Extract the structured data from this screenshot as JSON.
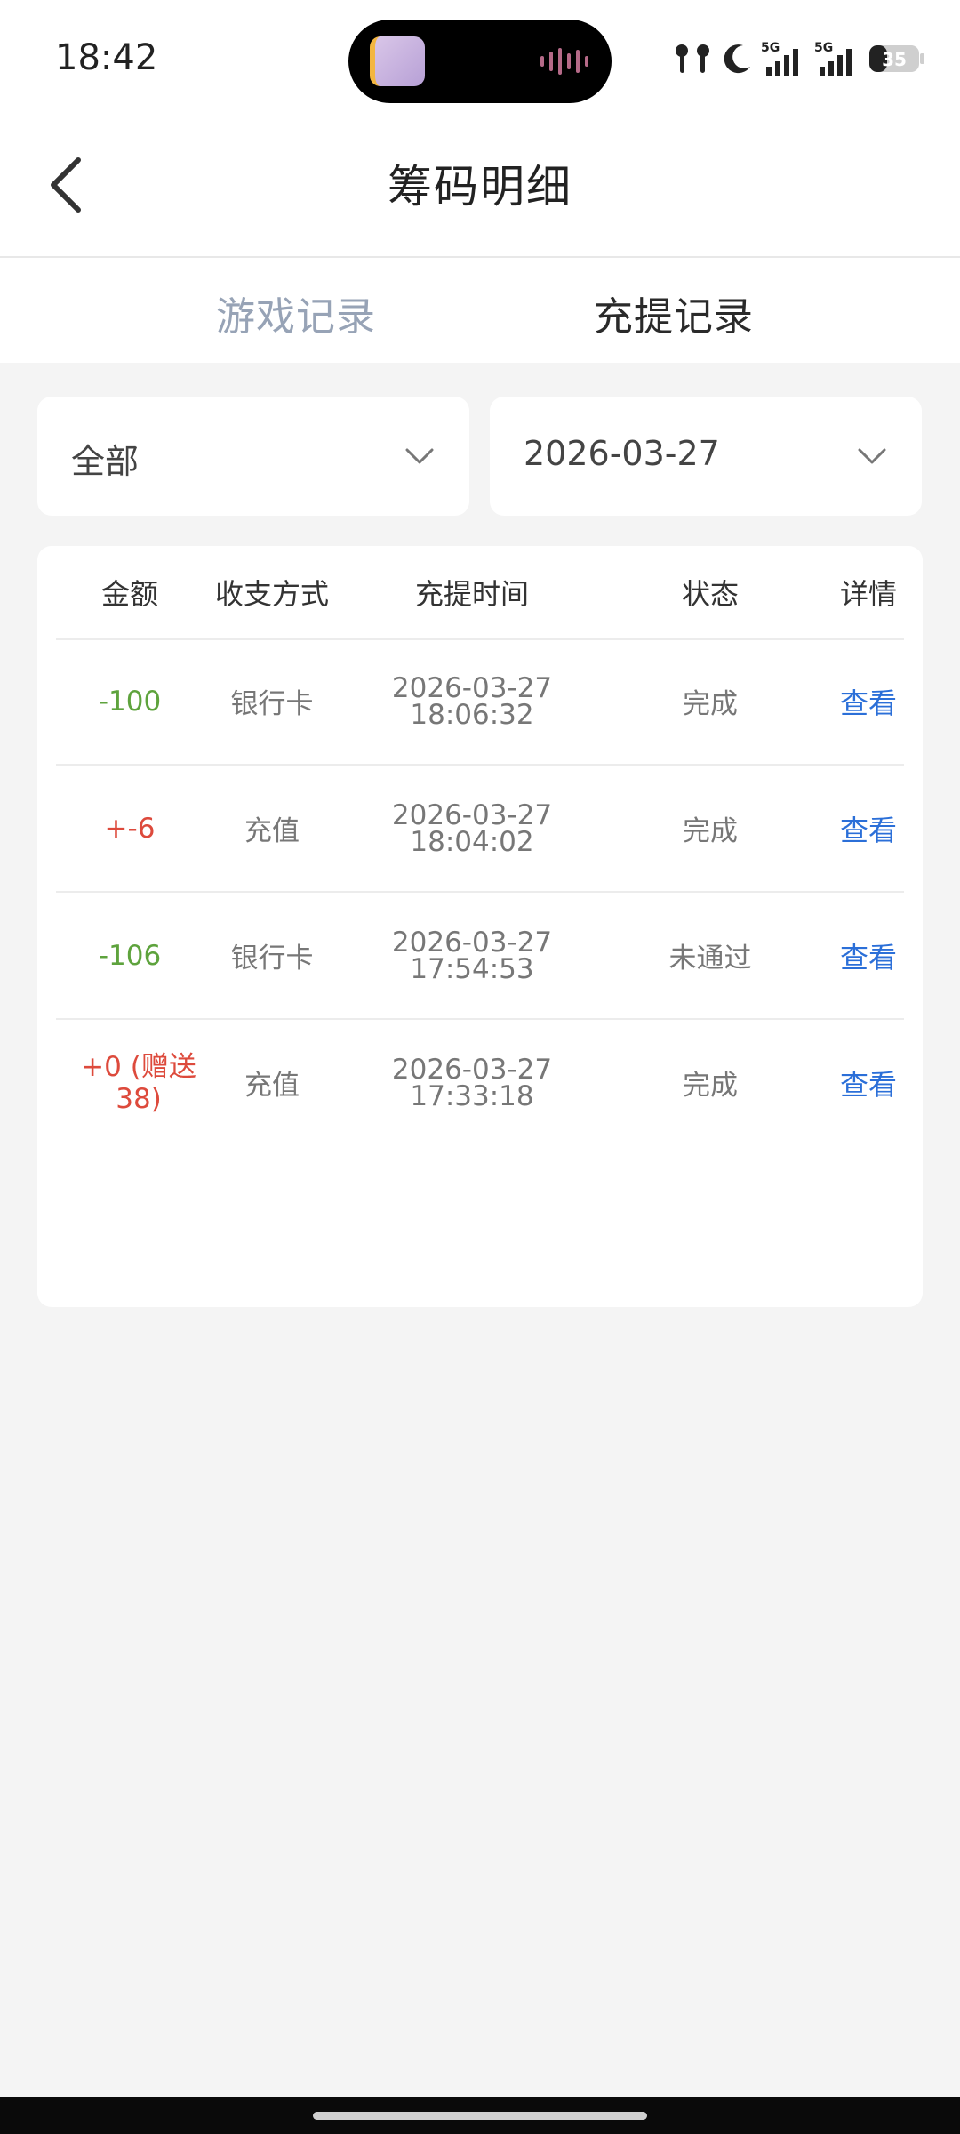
{
  "status_bar": {
    "time": "18:42",
    "network_1": "5G",
    "network_2": "5G",
    "battery": "35",
    "icons": [
      "earbuds-icon",
      "moon-icon",
      "signal-icon",
      "signal-icon",
      "battery-icon"
    ]
  },
  "header": {
    "title": "筹码明细",
    "back_icon": "chevron-left-icon"
  },
  "tabs": [
    {
      "label": "游戏记录",
      "active": false
    },
    {
      "label": "充提记录",
      "active": true
    }
  ],
  "filters": {
    "type": {
      "value": "全部",
      "icon": "chevron-down-icon"
    },
    "date": {
      "value": "2026-03-27",
      "icon": "chevron-down-icon"
    }
  },
  "table": {
    "columns": [
      "金额",
      "收支方式",
      "充提时间",
      "状态",
      "详情"
    ],
    "rows": [
      {
        "amount": "-100",
        "method": "银行卡",
        "date": "2026-03-27",
        "time": "18:06:32",
        "status": "完成",
        "detail": "查看"
      },
      {
        "amount": "+-6",
        "method": "充值",
        "date": "2026-03-27",
        "time": "18:04:02",
        "status": "完成",
        "detail": "查看"
      },
      {
        "amount": "-106",
        "method": "银行卡",
        "date": "2026-03-27",
        "time": "17:54:53",
        "status": "未通过",
        "detail": "查看"
      },
      {
        "amount": "+0 (赠送38)",
        "method": "充值",
        "date": "2026-03-27",
        "time": "17:33:18",
        "status": "完成",
        "detail": "查看"
      }
    ]
  },
  "colors": {
    "negative": "#5ea33d",
    "positive": "#dd4a3c",
    "link": "#2b6fd8",
    "inactive_tab": "#97a3b6"
  }
}
